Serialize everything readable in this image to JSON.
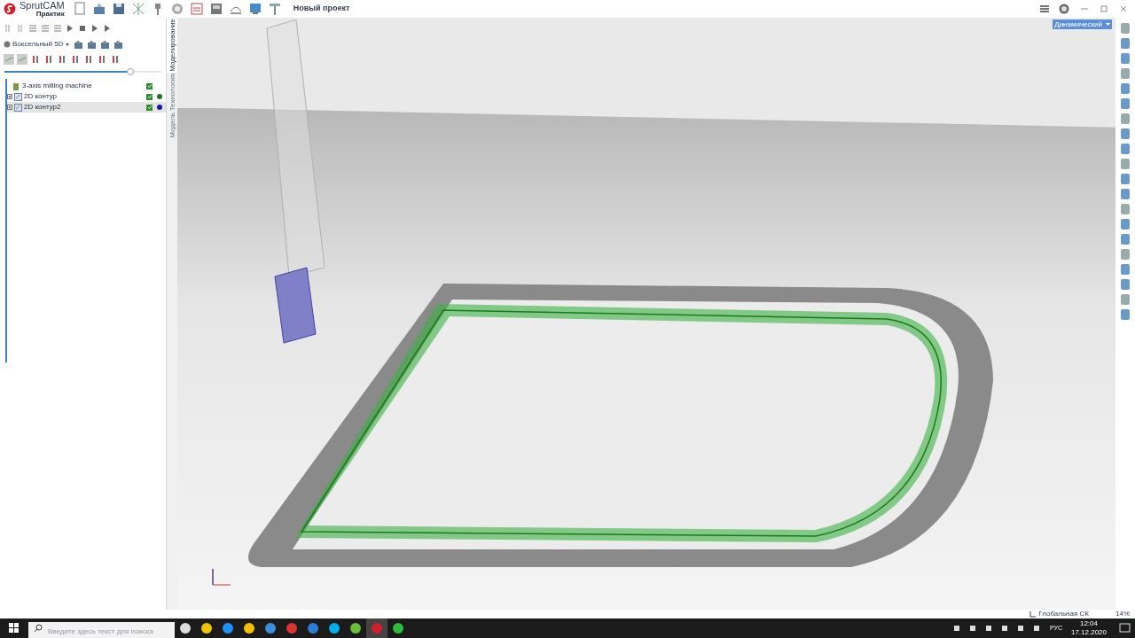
{
  "app": {
    "logo_name": "SprutCAM",
    "logo_edition": "Практик",
    "project_title": "Новый проект"
  },
  "left_panel": {
    "mode_dropdown": "Воксельный 5D",
    "simulation_slider": {
      "level": 0.8
    },
    "tree": [
      {
        "label": "3-axis milling machine",
        "kind": "machine",
        "checked": true,
        "selected": false
      },
      {
        "label": "2D контур",
        "kind": "operation",
        "checked": true,
        "selected": false,
        "color": "#1a7a1a"
      },
      {
        "label": "2D контур2",
        "kind": "operation",
        "checked": true,
        "selected": true,
        "color": "#1a1aa0"
      }
    ]
  },
  "side_tabs": [
    {
      "label": "Модель",
      "selected": false
    },
    {
      "label": "Технология",
      "selected": false
    },
    {
      "label": "Моделирование",
      "selected": true
    }
  ],
  "viewport": {
    "view_dropdown": "Динамический"
  },
  "status_bar": {
    "coordinate_system": "Глобальная СК",
    "zoom": "14%"
  },
  "taskbar": {
    "search_placeholder": "Введите здесь текст для поиска",
    "language": "РУС",
    "time": "12:04",
    "date": "17.12.2020"
  }
}
